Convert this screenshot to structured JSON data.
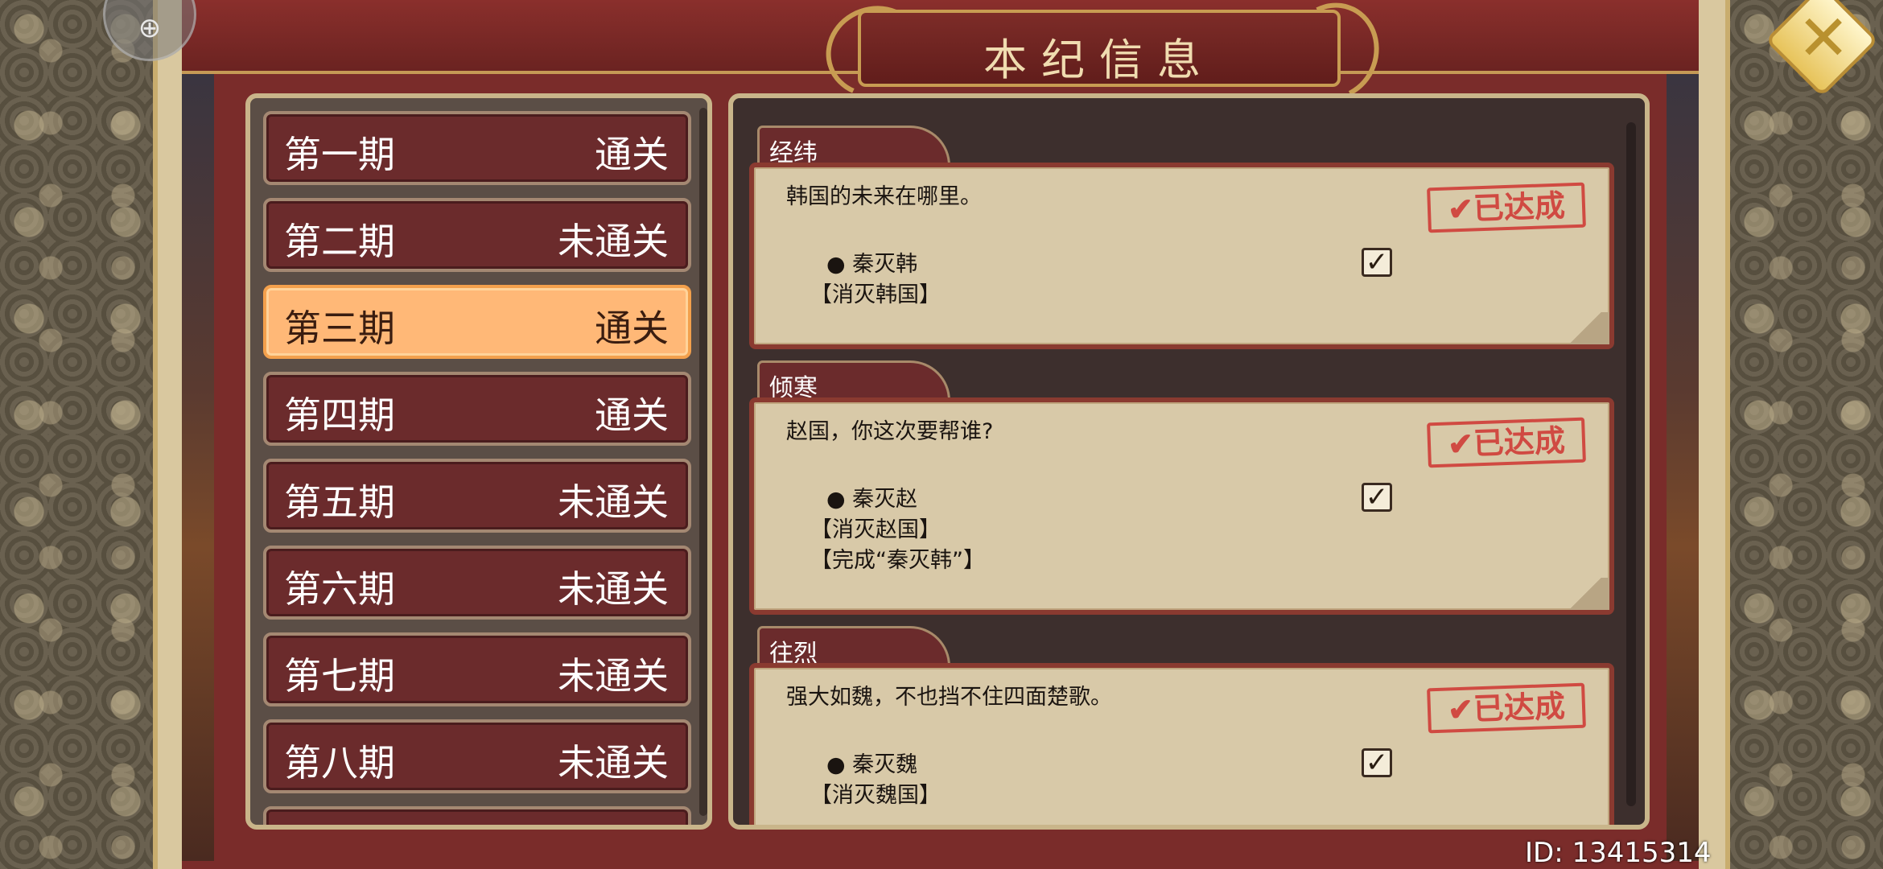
{
  "window": {
    "title": "本纪信息",
    "close_icon": "close-x-icon",
    "corner_icon": "settings-icon"
  },
  "periods": [
    {
      "name": "第一期",
      "status": "通关"
    },
    {
      "name": "第二期",
      "status": "未通关"
    },
    {
      "name": "第三期",
      "status": "通关",
      "selected": true
    },
    {
      "name": "第四期",
      "status": "通关"
    },
    {
      "name": "第五期",
      "status": "未通关"
    },
    {
      "name": "第六期",
      "status": "未通关"
    },
    {
      "name": "第七期",
      "status": "未通关"
    },
    {
      "name": "第八期",
      "status": "未通关"
    }
  ],
  "quests": [
    {
      "tab": "经纬",
      "description": "韩国的未来在哪里。",
      "stamp": "✔已达成",
      "conditions": [
        "● 秦灭韩",
        "【消灭韩国】"
      ],
      "checked": true
    },
    {
      "tab": "倾寒",
      "description": "赵国，你这次要帮谁?",
      "stamp": "✔已达成",
      "conditions": [
        "● 秦灭赵",
        "【消灭赵国】",
        "【完成“秦灭韩”】"
      ],
      "checked": true
    },
    {
      "tab": "往烈",
      "description": "强大如魏，不也挡不住四面楚歌。",
      "stamp": "✔已达成",
      "conditions": [
        "● 秦灭魏",
        "【消灭魏国】"
      ],
      "checked": true
    }
  ],
  "footer": {
    "id_text": "ID: 13415314"
  },
  "colors": {
    "panel_red": "#6b2b2c",
    "selected_orange": "#ffb877",
    "stamp_red": "#d04a42",
    "parchment": "#d8c9a8"
  }
}
